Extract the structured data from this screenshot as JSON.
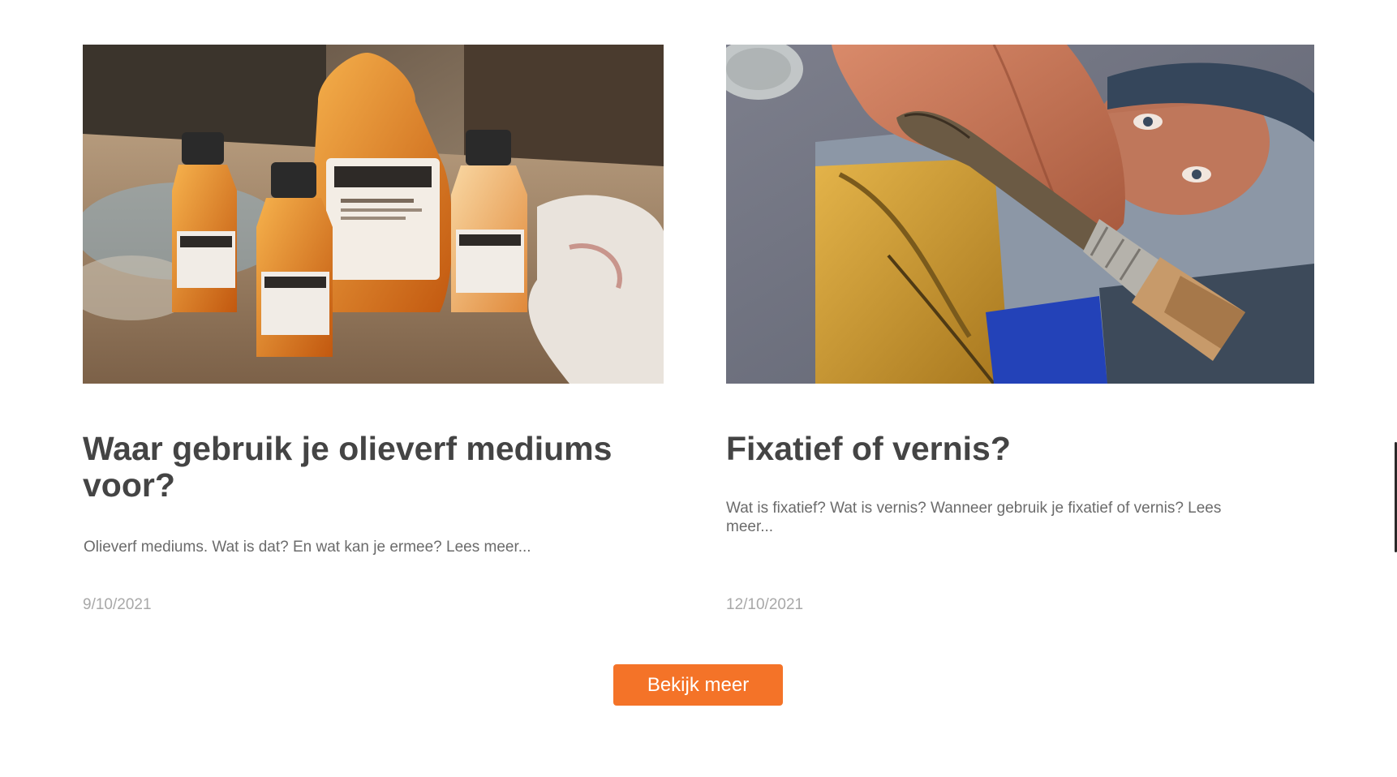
{
  "posts": [
    {
      "title": "Waar gebruik je olieverf mediums voor?",
      "excerpt": "Olieverf mediums. Wat is dat? En wat kan je ermee? Lees meer...",
      "date": "9/10/2021",
      "image_icon": "oil-medium-bottles-photo"
    },
    {
      "title": "Fixatief of vernis?",
      "excerpt": "Wat is fixatief? Wat is vernis? Wanneer gebruik je fixatief of vernis? Lees meer...",
      "date": "12/10/2021",
      "image_icon": "varnish-brush-photo"
    }
  ],
  "more_button": {
    "label": "Bekijk meer"
  },
  "colors": {
    "accent": "#f47328",
    "title": "#444444",
    "excerpt": "#6b6b6b",
    "date": "#a8a8a8"
  }
}
